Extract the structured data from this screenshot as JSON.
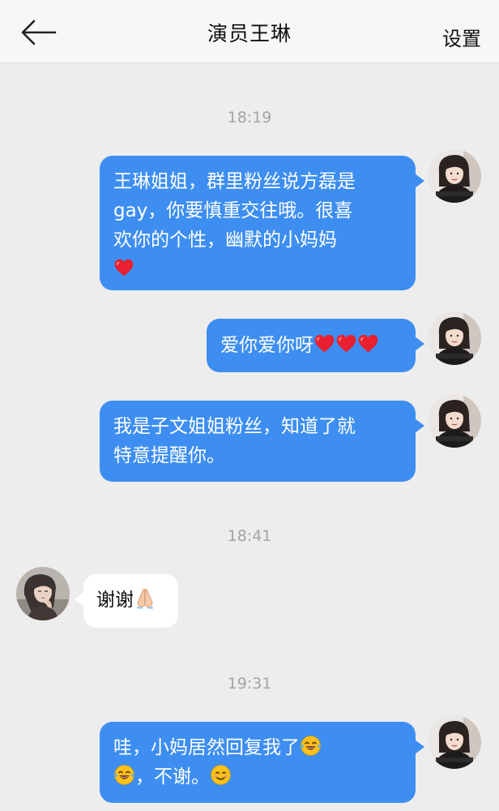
{
  "header": {
    "title": "演员王琳",
    "settings_label": "设置"
  },
  "colors": {
    "my_bubble": "#3d8ef0",
    "other_bubble": "#ffffff",
    "background": "#ededed",
    "header_bg": "#f7f7f7"
  },
  "icons": {
    "back": "back-arrow-icon",
    "heart": "red-heart-icon",
    "pray": "folded-hands-icon",
    "laugh": "tears-of-joy-icon",
    "smile": "smiling-face-icon"
  },
  "messages": {
    "t1": "18:19",
    "m1_line1": "王琳姐姐，群里粉丝说方磊是",
    "m1_line2": "gay，你要慎重交往哦。很喜",
    "m1_line3": "欢你的个性，幽默的小妈妈",
    "m2_text": "爱你爱你呀",
    "m3_line1": "我是子文姐姐粉丝，知道了就",
    "m3_line2": "特意提醒你。",
    "t2": "18:41",
    "m4_text": "谢谢",
    "t3": "19:31",
    "m5_line1": "哇，小妈居然回复我了",
    "m5_line2": "，不谢。"
  }
}
